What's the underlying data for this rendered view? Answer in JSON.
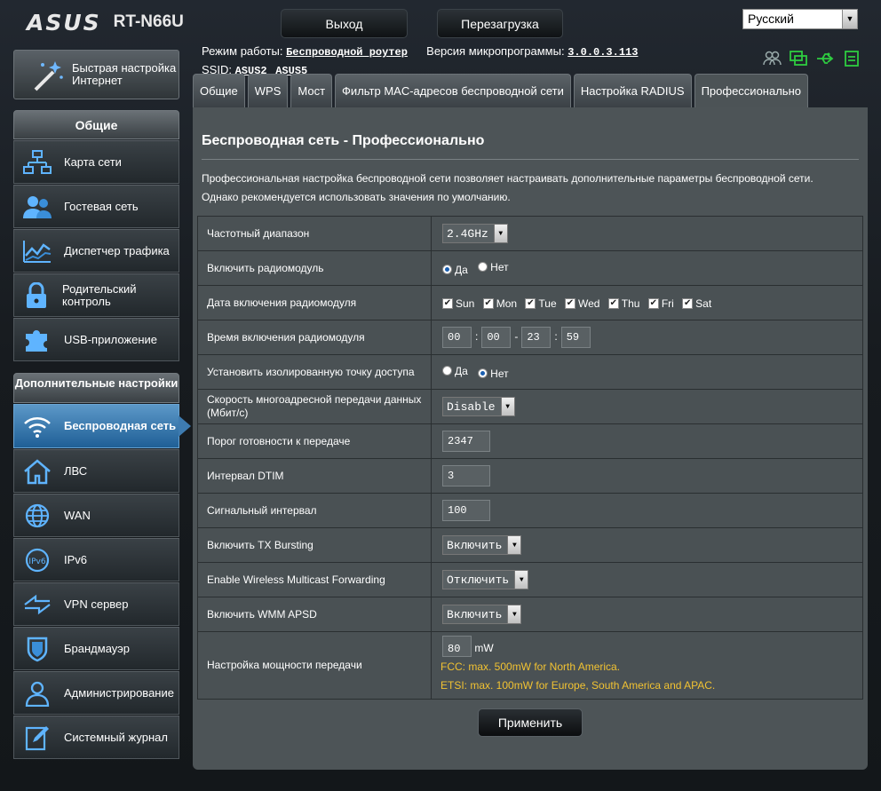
{
  "header": {
    "brand": "ASUS",
    "model": "RT-N66U",
    "logout_label": "Выход",
    "reboot_label": "Перезагрузка",
    "language": "Русский"
  },
  "status": {
    "mode_label": "Режим работы:",
    "mode_value": "Беспроводной роутер",
    "fw_label": "Версия микропрограммы:",
    "fw_value": "3.0.0.3.113",
    "ssid_label": "SSID:",
    "ssid_1": "ASUS2",
    "ssid_2": "ASUS5"
  },
  "sidebar": {
    "quick_setup": "Быстрая настройка Интернет",
    "general_header": "Общие",
    "general_items": [
      {
        "label": "Карта сети",
        "icon": "network-map-icon"
      },
      {
        "label": "Гостевая сеть",
        "icon": "guest-network-icon"
      },
      {
        "label": "Диспетчер трафика",
        "icon": "traffic-manager-icon"
      },
      {
        "label": "Родительский контроль",
        "icon": "parental-control-icon"
      },
      {
        "label": "USB-приложение",
        "icon": "usb-app-icon"
      }
    ],
    "advanced_header": "Дополнительные настройки",
    "advanced_items": [
      {
        "label": "Беспроводная сеть",
        "icon": "wireless-icon",
        "active": true
      },
      {
        "label": "ЛВС",
        "icon": "lan-icon"
      },
      {
        "label": "WAN",
        "icon": "wan-icon"
      },
      {
        "label": "IPv6",
        "icon": "ipv6-icon"
      },
      {
        "label": "VPN сервер",
        "icon": "vpn-icon"
      },
      {
        "label": "Брандмауэр",
        "icon": "firewall-icon"
      },
      {
        "label": "Администри­рование",
        "icon": "admin-icon"
      },
      {
        "label": "Системный журнал",
        "icon": "system-log-icon"
      }
    ]
  },
  "tabs": [
    "Общие",
    "WPS",
    "Мост",
    "Фильтр MAC-адресов беспроводной сети",
    "Настройка RADIUS",
    "Профессионально"
  ],
  "main": {
    "title": "Беспроводная сеть - Профессионально",
    "desc_line1": "Профессиональная настройка беспроводной сети позволяет настраивать дополнительные параметры беспроводной сети.",
    "desc_line2": "Однако рекомендуется использовать значения по умолчанию.",
    "rows": {
      "band": {
        "label": "Частотный диапазон",
        "value": "2.4GHz"
      },
      "radio": {
        "label": "Включить радиомодуль",
        "yes": "Да",
        "no": "Нет",
        "selected": "yes"
      },
      "radio_date": {
        "label": "Дата включения радиомодуля",
        "days": [
          "Sun",
          "Mon",
          "Tue",
          "Wed",
          "Thu",
          "Fri",
          "Sat"
        ]
      },
      "radio_time": {
        "label": "Время включения радиомодуля",
        "h1": "00",
        "m1": "00",
        "h2": "23",
        "m2": "59",
        "sep": "-"
      },
      "isolate": {
        "label": "Установить изолированную точку доступа",
        "yes": "Да",
        "no": "Нет",
        "selected": "no"
      },
      "multicast": {
        "label": "Скорость многоадресной передачи данных (Мбит/с)",
        "value": "Disable"
      },
      "rts": {
        "label": "Порог готовности к передаче",
        "value": "2347"
      },
      "dtim": {
        "label": "Интервал DTIM",
        "value": "3"
      },
      "beacon": {
        "label": "Сигнальный интервал",
        "value": "100"
      },
      "txburst": {
        "label": "Включить TX Bursting",
        "value": "Включить"
      },
      "wmf": {
        "label": "Enable Wireless Multicast Forwarding",
        "value": "Отключить"
      },
      "apsd": {
        "label": "Включить WMM APSD",
        "value": "Включить"
      },
      "txpower": {
        "label": "Настройка мощности передачи",
        "value": "80",
        "unit": "mW",
        "note1": "FCC: max. 500mW for North America.",
        "note2": "ETSI: max. 100mW for Europe, South America and APAC."
      }
    },
    "apply_label": "Применить"
  },
  "colors": {
    "accent": "#3e7bb0",
    "note": "#f1c232",
    "panel": "#4d5457"
  }
}
